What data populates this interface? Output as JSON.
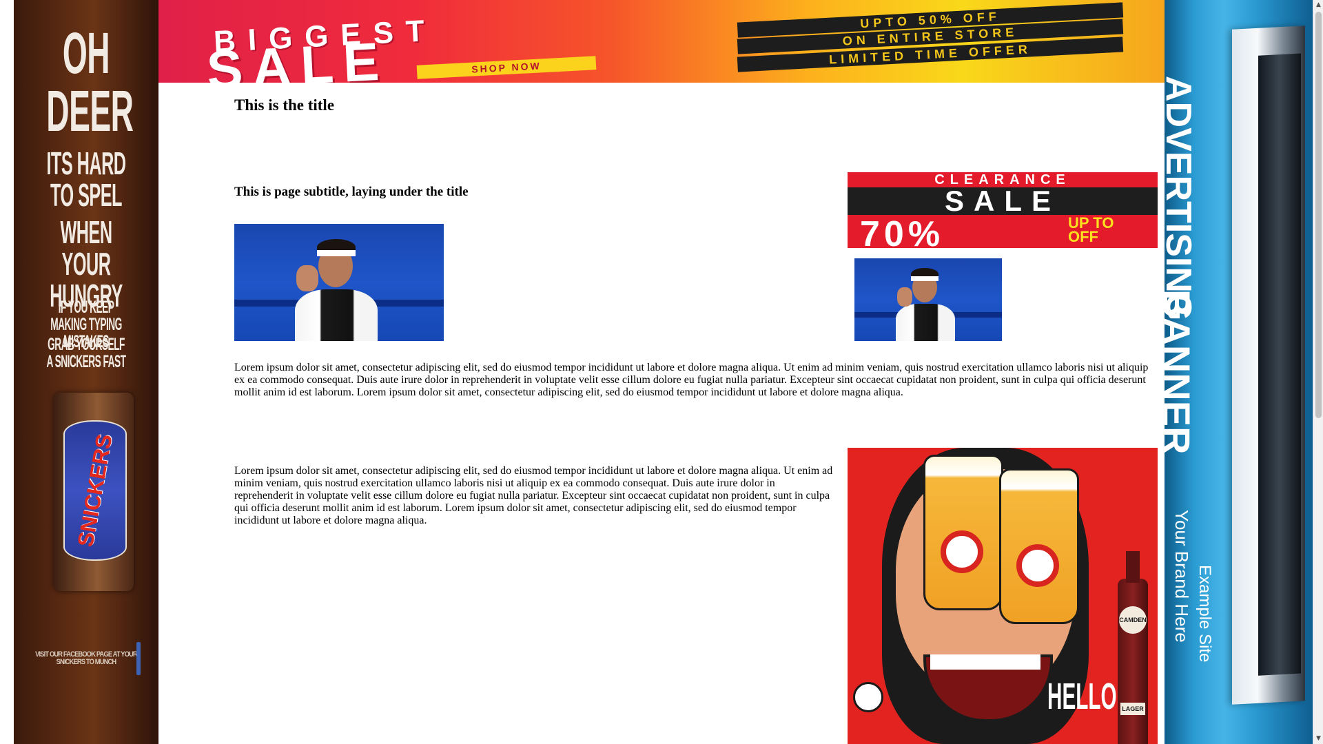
{
  "ads": {
    "left": {
      "lines": [
        "OH DEER",
        "ITS HARD TO SPEL",
        "WHEN YOUR HUNGRY",
        "IF YOU KEEP MAKING TYPING MISTAKES",
        "GRAB YOURSELF A SNICKERS FAST"
      ],
      "brand": "SNICKERS",
      "footer": "VISIT OUR FACEBOOK PAGE AT YOUR SNICKERS TO MUNCH"
    },
    "top": {
      "headline_1": "BIGGEST",
      "headline_2": "SALE",
      "cta": "SHOP NOW",
      "offers": [
        "UPTO 50% OFF",
        "ON ENTIRE STORE",
        "LIMITED TIME OFFER"
      ]
    },
    "right": {
      "lines": [
        "ADVERTISING",
        "BANNER",
        "Your Brand Here",
        "Example Site"
      ]
    },
    "clearance": {
      "line_1": "CLEARANCE",
      "line_2": "SALE",
      "percent": "70%",
      "upto": "UP TO",
      "off": "OFF"
    },
    "beer": {
      "headline": "HELLO",
      "bottle_label": "CAMDEN",
      "bottle_sub": "LAGER"
    }
  },
  "main": {
    "title": "This is the title",
    "subtitle": "This is page subtitle, laying under the title",
    "paragraph_1": "Lorem ipsum dolor sit amet, consectetur adipiscing elit, sed do eiusmod tempor incididunt ut labore et dolore magna aliqua. Ut enim ad minim veniam, quis nostrud exercitation ullamco laboris nisi ut aliquip ex ea commodo consequat. Duis aute irure dolor in reprehenderit in voluptate velit esse cillum dolore eu fugiat nulla pariatur. Excepteur sint occaecat cupidatat non proident, sunt in culpa qui officia deserunt mollit anim id est laborum. Lorem ipsum dolor sit amet, consectetur adipiscing elit, sed do eiusmod tempor incididunt ut labore et dolore magna aliqua.",
    "paragraph_2": "Lorem ipsum dolor sit amet, consectetur adipiscing elit, sed do eiusmod tempor incididunt ut labore et dolore magna aliqua. Ut enim ad minim veniam, quis nostrud exercitation ullamco laboris nisi ut aliquip ex ea commodo consequat. Duis aute irure dolor in reprehenderit in voluptate velit esse cillum dolore eu fugiat nulla pariatur. Excepteur sint occaecat cupidatat non proident, sunt in culpa qui officia deserunt mollit anim id est laborum. Lorem ipsum dolor sit amet, consectetur adipiscing elit, sed do eiusmod tempor incididunt ut labore et dolore magna aliqua."
  },
  "scrollbar": {
    "up_icon": "▲",
    "down_icon": "▼"
  },
  "colors": {
    "left_ad_bg": "#5a2a12",
    "right_ad_bg": "#2b9cd3",
    "clearance_red": "#e31b2b",
    "beer_red": "#e3231f"
  }
}
